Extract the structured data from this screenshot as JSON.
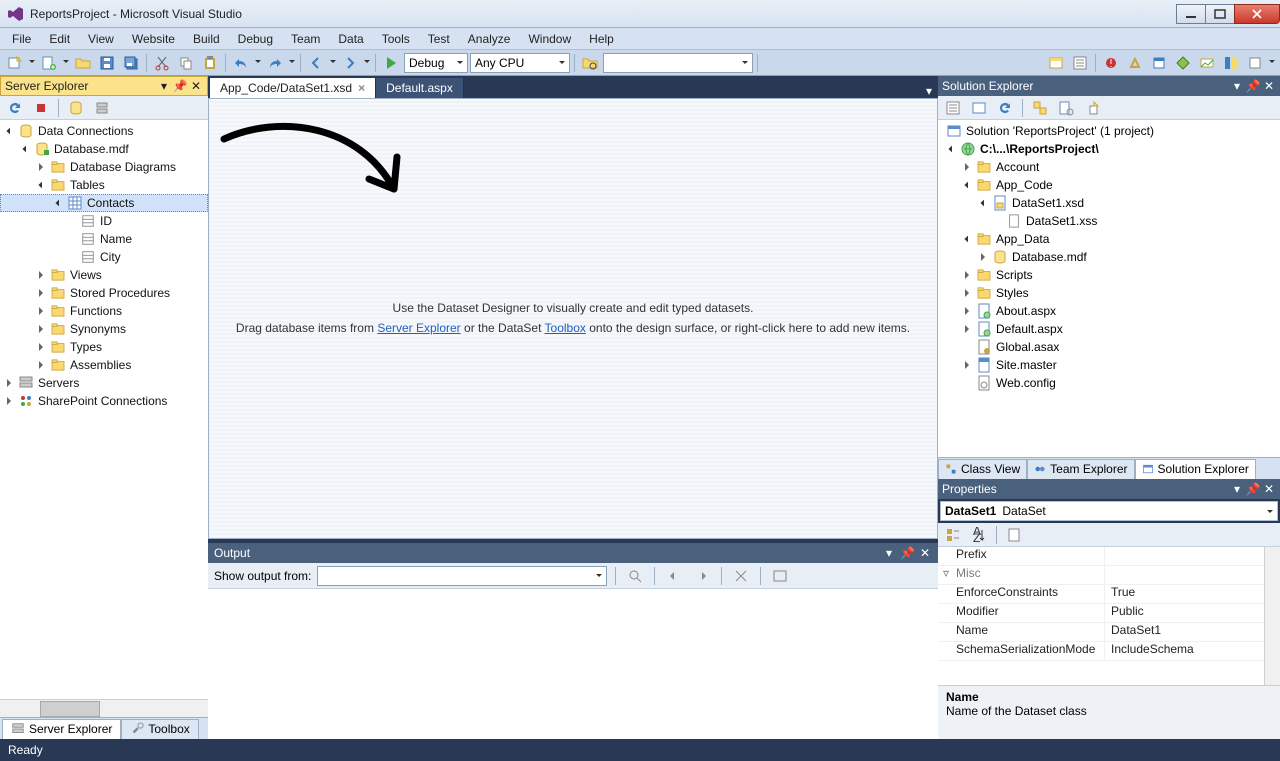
{
  "window": {
    "title": "ReportsProject - Microsoft Visual Studio"
  },
  "menu": [
    "File",
    "Edit",
    "View",
    "Website",
    "Build",
    "Debug",
    "Team",
    "Data",
    "Tools",
    "Test",
    "Analyze",
    "Window",
    "Help"
  ],
  "toolbar": {
    "config": "Debug",
    "platform": "Any CPU"
  },
  "server_explorer": {
    "title": "Server Explorer",
    "nodes": {
      "data_connections": "Data Connections",
      "database": "Database.mdf",
      "db_diagrams": "Database Diagrams",
      "tables": "Tables",
      "contacts": "Contacts",
      "col_id": "ID",
      "col_name": "Name",
      "col_city": "City",
      "views": "Views",
      "sprocs": "Stored Procedures",
      "functions": "Functions",
      "synonyms": "Synonyms",
      "types": "Types",
      "assemblies": "Assemblies",
      "servers": "Servers",
      "sharepoint": "SharePoint Connections"
    },
    "tabs": {
      "server_explorer": "Server Explorer",
      "toolbox": "Toolbox"
    }
  },
  "tabs": {
    "active": "App_Code/DataSet1.xsd",
    "inactive": "Default.aspx"
  },
  "designer": {
    "line1": "Use the Dataset Designer to visually create and edit typed datasets.",
    "line2a": "Drag database items from ",
    "link1": "Server Explorer",
    "line2b": " or the DataSet ",
    "link2": "Toolbox",
    "line2c": " onto the design surface, or right-click here to add new items."
  },
  "output": {
    "title": "Output",
    "label": "Show output from:"
  },
  "solution_explorer": {
    "title": "Solution Explorer",
    "solution": "Solution 'ReportsProject' (1 project)",
    "project": "C:\\...\\ReportsProject\\",
    "nodes": {
      "account": "Account",
      "app_code": "App_Code",
      "dataset_xsd": "DataSet1.xsd",
      "dataset_xss": "DataSet1.xss",
      "app_data": "App_Data",
      "database": "Database.mdf",
      "scripts": "Scripts",
      "styles": "Styles",
      "about": "About.aspx",
      "default": "Default.aspx",
      "global": "Global.asax",
      "sitemaster": "Site.master",
      "webconfig": "Web.config"
    },
    "tabs": {
      "class_view": "Class View",
      "team_explorer": "Team Explorer",
      "solution_explorer": "Solution Explorer"
    }
  },
  "properties": {
    "title": "Properties",
    "object_name": "DataSet1",
    "object_type": "DataSet",
    "rows": {
      "prefix": "Prefix",
      "misc": "Misc",
      "enforce": "EnforceConstraints",
      "enforce_val": "True",
      "modifier": "Modifier",
      "modifier_val": "Public",
      "name": "Name",
      "name_val": "DataSet1",
      "ssm": "SchemaSerializationMode",
      "ssm_val": "IncludeSchema"
    },
    "desc_title": "Name",
    "desc_body": "Name of the Dataset class"
  },
  "status": {
    "ready": "Ready"
  }
}
